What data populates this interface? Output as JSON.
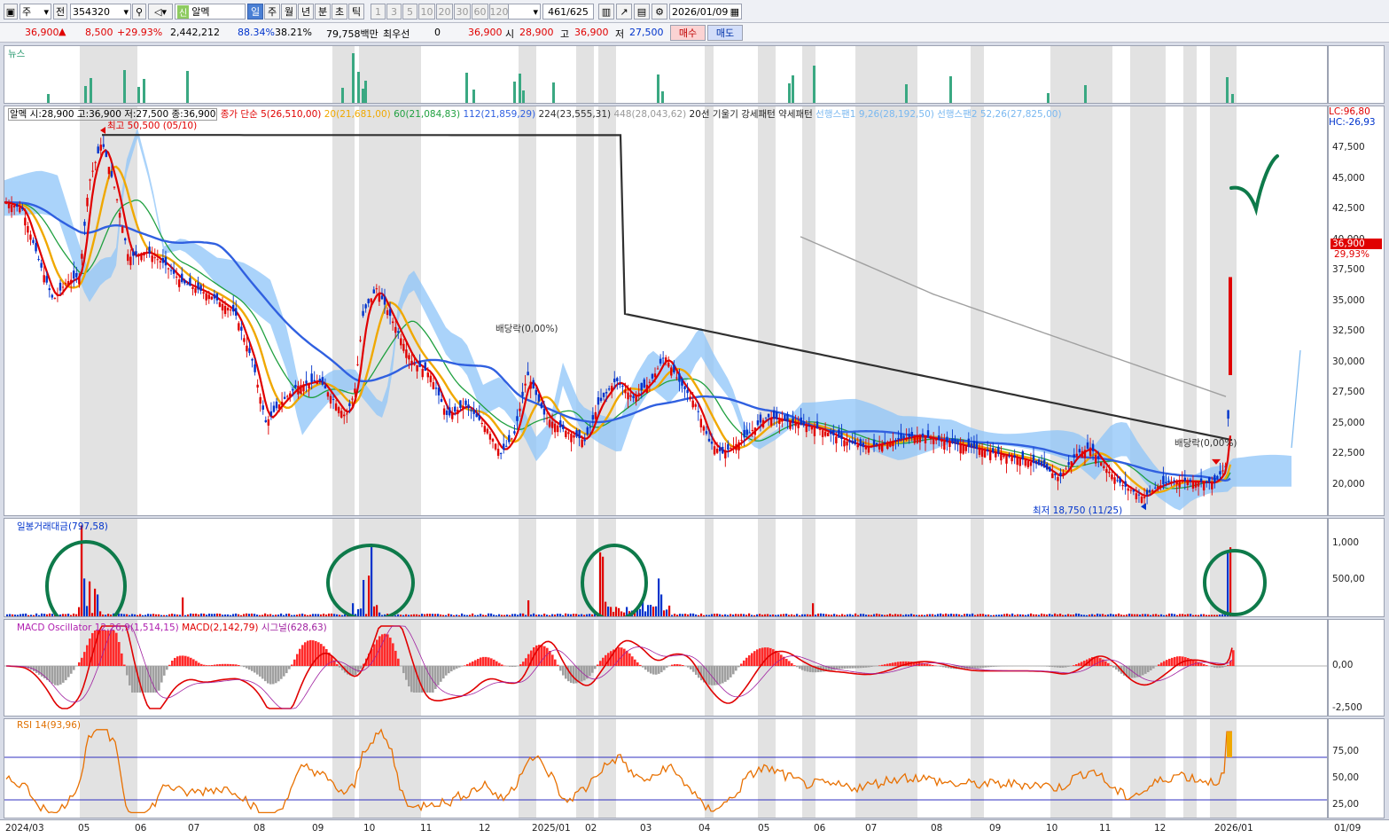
{
  "toolbar": {
    "period_selector": "주",
    "prefix": "전",
    "code": "354320",
    "stock_name": "알멕",
    "stock_badge": "신",
    "period_tabs": [
      {
        "label": "일",
        "active": true
      },
      {
        "label": "주"
      },
      {
        "label": "월"
      },
      {
        "label": "년"
      },
      {
        "label": "분"
      },
      {
        "label": "초"
      },
      {
        "label": "틱"
      }
    ],
    "number_tabs": [
      "1",
      "3",
      "5",
      "10",
      "20",
      "30",
      "60",
      "120"
    ],
    "count": "461",
    "count_total": "/625",
    "date": "2026/01/09"
  },
  "quote": {
    "price": "36,900",
    "change": "8,500",
    "change_pct": "+29.93%",
    "volume": "2,442,212",
    "vol_ratio": "88.34%",
    "turnover": "38.21%",
    "amount": "79,758백만",
    "pref_label": "최우선",
    "pref_value": "0",
    "pref_price": "36,900",
    "open_label": "시",
    "open": "28,900",
    "high_label": "고",
    "high": "36,900",
    "low_label": "저",
    "low": "27,500",
    "buy": "매수",
    "sell": "매도"
  },
  "panels": {
    "news": {
      "title": "뉴스"
    },
    "price": {
      "legend_name": "알멕 시:28,900 고:36,900 저:27,500 종:36,900",
      "ma5": "종가 단순 5(26,510,00)",
      "ma20": "20(21,681,00)",
      "ma60": "60(21,084,83)",
      "ma112": "112(21,859,29)",
      "ma224": "224(23,555,31)",
      "ma448": "448(28,043,62)",
      "pattern": "20선 기울기 강세패턴  약세패턴",
      "span1": "선행스팬1 9,26(28,192,50)",
      "span2": "선행스팬2 52,26(27,825,00)",
      "high_label": "최고 50,500 (05/10)",
      "low_label": "최저 18,750 (11/25)",
      "div1": "배당락(0,00%)",
      "div2": "배당락(0,00%)",
      "lc": "LC:96,80",
      "hc": "HC:-26,93",
      "cur_tag": "36,900",
      "cur_pct": "29,93%",
      "yticks": [
        "47,500",
        "45,000",
        "42,500",
        "40,000",
        "37,500",
        "35,000",
        "32,500",
        "30,000",
        "27,500",
        "25,000",
        "22,500",
        "20,000"
      ]
    },
    "volume": {
      "title": "일봉거래대금(797,58)",
      "yticks": [
        "1,000",
        "500,00"
      ]
    },
    "macd": {
      "osc": "MACD Oscillator 12,26,9(1,514,15)",
      "macd": "MACD(2,142,79)",
      "signal": "시그널(628,63)",
      "yticks": [
        "0,00",
        "-2,500"
      ]
    },
    "rsi": {
      "title": "RSI 14(93,96)",
      "yticks": [
        "75,00",
        "50,00",
        "25,00"
      ]
    }
  },
  "xaxis": [
    "2024/03",
    "05",
    "06",
    "07",
    "08",
    "09",
    "10",
    "11",
    "12",
    "2025/01",
    "02",
    "03",
    "04",
    "05",
    "06",
    "07",
    "08",
    "09",
    "10",
    "11",
    "12",
    "2026/01",
    "01/09"
  ],
  "colors": {
    "ma5": "#e00000",
    "ma20": "#f0a800",
    "ma60": "#20a040",
    "ma112": "#3060e0",
    "ma224": "#303030",
    "ma448": "#a0a0a0",
    "cloud": "#8ec4f8",
    "up": "#e00000",
    "down": "#0033cc",
    "circle": "#0e7a4a"
  }
}
